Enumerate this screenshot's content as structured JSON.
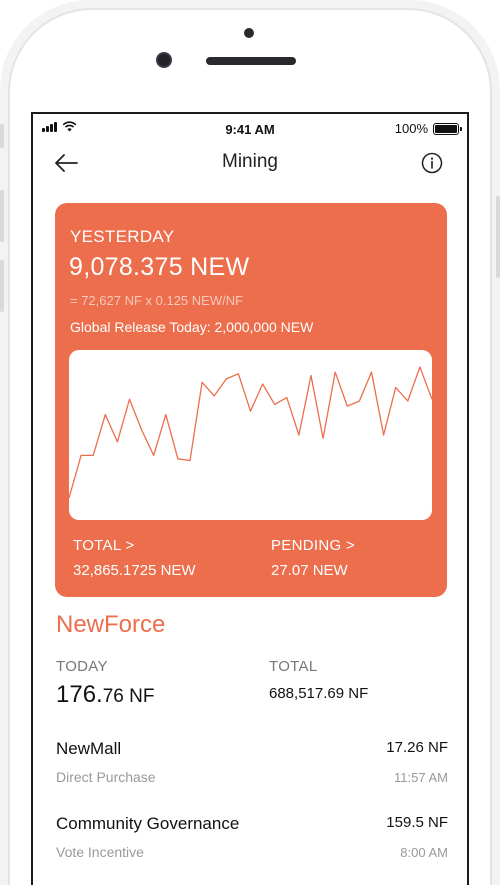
{
  "status_bar": {
    "time": "9:41 AM",
    "battery": "100%"
  },
  "nav": {
    "title": "Mining"
  },
  "card": {
    "label": "YESTERDAY",
    "amount": "9,078.375 NEW",
    "formula": "= 72,627 NF x 0.125 NEW/NF",
    "release": "Global Release Today: 2,000,000 NEW",
    "total_label": "TOTAL >",
    "total_value": "32,865.1725 NEW",
    "pending_label": "PENDING >",
    "pending_value": "27.07 NEW"
  },
  "chart_data": {
    "type": "line",
    "series": [
      {
        "values": [
          0.13,
          0.38,
          0.38,
          0.62,
          0.46,
          0.71,
          0.53,
          0.38,
          0.62,
          0.36,
          0.35,
          0.81,
          0.73,
          0.83,
          0.86,
          0.64,
          0.8,
          0.68,
          0.72,
          0.5,
          0.85,
          0.48,
          0.87,
          0.67,
          0.7,
          0.87,
          0.5,
          0.78,
          0.7,
          0.9,
          0.71
        ]
      }
    ],
    "ylim": [
      0,
      1
    ]
  },
  "colors": {
    "accent": "#ec6e4d"
  },
  "newforce": {
    "title": "NewForce",
    "today_label": "TODAY",
    "today_int": "176.",
    "today_dec": "76 NF",
    "total_label": "TOTAL",
    "total_value": "688,517.69 NF"
  },
  "transactions": [
    {
      "name": "NewMall",
      "sub": "Direct Purchase",
      "amount": "17.26 NF",
      "time": "11:57 AM"
    },
    {
      "name": "Community Governance",
      "sub": "Vote Incentive",
      "amount": "159.5 NF",
      "time": "8:00 AM"
    }
  ],
  "icons": {
    "back": "arrow-left-icon",
    "info": "info-icon"
  }
}
